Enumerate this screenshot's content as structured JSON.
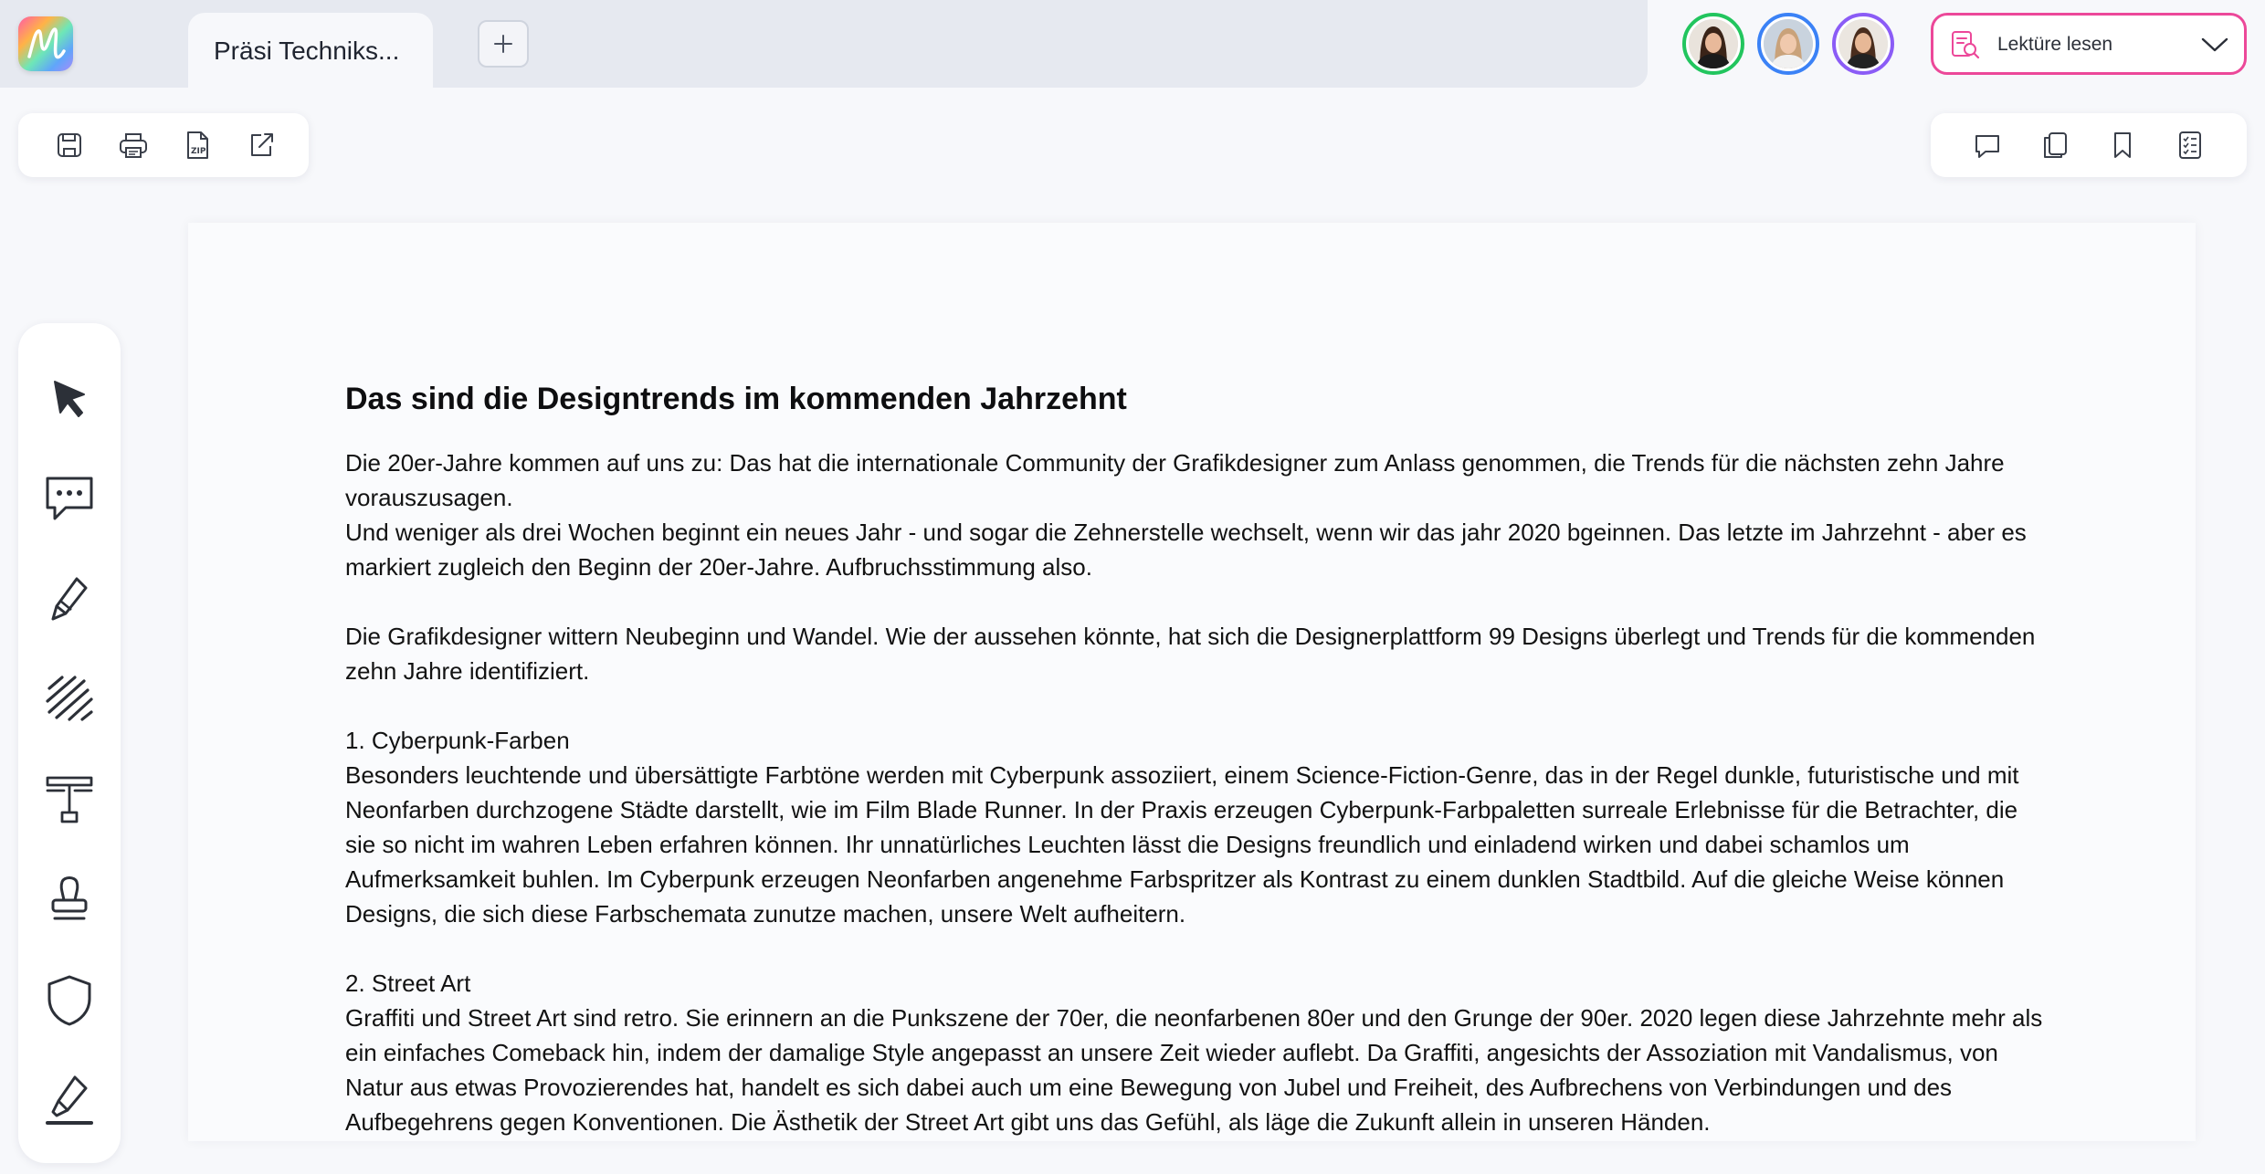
{
  "app": {
    "logo_letter": "M",
    "tab_title": "Präsi Techniks...",
    "new_tab_symbol": "+"
  },
  "collaborators": [
    {
      "ring_color": "#22c55e"
    },
    {
      "ring_color": "#3b82f6"
    },
    {
      "ring_color": "#8b5cf6"
    }
  ],
  "mode_select": {
    "label": "Lektüre lesen",
    "icon": "document-search-icon",
    "accent": "#ec4899"
  },
  "file_toolbar": {
    "buttons": [
      "save-icon",
      "print-icon",
      "zip-icon",
      "export-icon"
    ]
  },
  "view_toolbar": {
    "buttons": [
      "comment-icon",
      "copy-icon",
      "bookmark-icon",
      "checklist-icon"
    ]
  },
  "tools": [
    "pointer-icon",
    "comment-bubble-icon",
    "pen-icon",
    "scribble-icon",
    "text-tool-icon",
    "stamp-icon",
    "shield-icon",
    "highlighter-icon"
  ],
  "document": {
    "title": "Das sind die Designtrends im kommenden Jahrzehnt",
    "p1": [
      "Die 20er-Jahre kommen auf uns zu: Das hat die internationale Community der Grafikdesigner zum Anlass genommen, die Trends für die nächsten zehn Jahre vorauszusagen.",
      "Und weniger als drei Wochen beginnt ein neues Jahr - und sogar die Zehnerstelle wechselt, wenn wir das jahr 2020 bgeinnen. Das letzte im Jahrzehnt - aber es markiert zugleich den Beginn der 20er-Jahre. Aufbruchsstimmung also."
    ],
    "p2": "Die Grafikdesigner wittern Neubeginn und Wandel. Wie der aussehen könnte, hat sich die Designerplattform 99 Designs überlegt und Trends für die kommenden zehn Jahre identifiziert.",
    "s1_heading": "1. Cyberpunk-Farben",
    "s1_body": "Besonders leuchtende und übersättigte Farbtöne werden mit Cyberpunk assoziiert, einem Science-Fiction-Genre, das in der Regel dunkle, futuristische und mit Neonfarben durchzogene Städte darstellt, wie im Film Blade Runner. In der Praxis erzeugen Cyberpunk-Farbpaletten surreale Erlebnisse für die Betrachter, die sie so nicht im wahren Leben erfahren können. Ihr unnatürliches Leuchten lässt die Designs freundlich und einladend wirken und dabei schamlos um Aufmerksamkeit buhlen. Im Cyberpunk erzeugen Neonfarben angenehme Farbspritzer als Kontrast zu einem dunklen Stadtbild. Auf die gleiche Weise können Designs, die sich diese Farbschemata zunutze machen, unsere Welt aufheitern.",
    "s2_heading": "2. Street Art",
    "s2_body": "Graffiti und Street Art sind retro. Sie erinnern an die Punkszene der 70er, die neonfarbenen 80er und den Grunge der 90er. 2020 legen diese Jahrzehnte mehr als ein einfaches Comeback hin, indem der damalige Style angepasst an unsere Zeit wieder auflebt. Da Graffiti, angesichts der Assoziation mit Vandalismus, von Natur aus etwas Provozierendes hat, handelt es sich dabei auch um eine Bewegung von Jubel und Freiheit, des Aufbrechens von Verbindungen und des Aufbegehrens gegen Konventionen. Die Ästhetik der Street Art gibt uns das Gefühl, als läge die Zukunft allein in unseren Händen."
  }
}
